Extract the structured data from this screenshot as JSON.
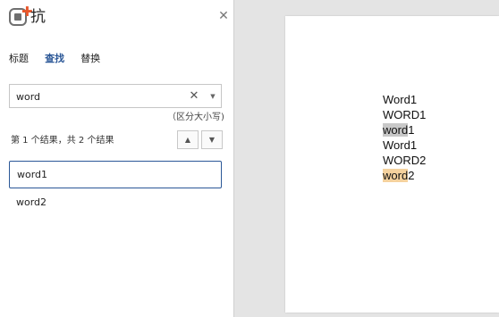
{
  "app": {
    "logo_text": "抗"
  },
  "nav": {
    "tabs": [
      {
        "label": "标题",
        "active": false
      },
      {
        "label": "查找",
        "active": true
      },
      {
        "label": "替换",
        "active": false
      }
    ],
    "search": {
      "value": "word",
      "placeholder": ""
    },
    "case_note": "（区分大小写)",
    "result_count": "第 1 个结果，共 2 个结果",
    "results": [
      {
        "label": "word1",
        "selected": true
      },
      {
        "label": "word2",
        "selected": false
      }
    ]
  },
  "document": {
    "lines": [
      {
        "highlight": "",
        "highlight_type": "none",
        "rest": "Word1"
      },
      {
        "highlight": "",
        "highlight_type": "none",
        "rest": "WORD1"
      },
      {
        "highlight": "word",
        "highlight_type": "current",
        "rest": "1"
      },
      {
        "highlight": "",
        "highlight_type": "none",
        "rest": "Word1"
      },
      {
        "highlight": "",
        "highlight_type": "none",
        "rest": "WORD2"
      },
      {
        "highlight": "word",
        "highlight_type": "match",
        "rest": "2"
      }
    ]
  },
  "colors": {
    "accent": "#2b5797",
    "current_highlight": "#c8c8c8",
    "match_highlight": "#f5d29e",
    "logo_plus": "#e8562a"
  },
  "icons": {
    "close": "close-icon",
    "clear": "clear-icon",
    "dropdown": "chevron-down-icon",
    "prev": "arrow-up-icon",
    "next": "arrow-down-icon"
  }
}
